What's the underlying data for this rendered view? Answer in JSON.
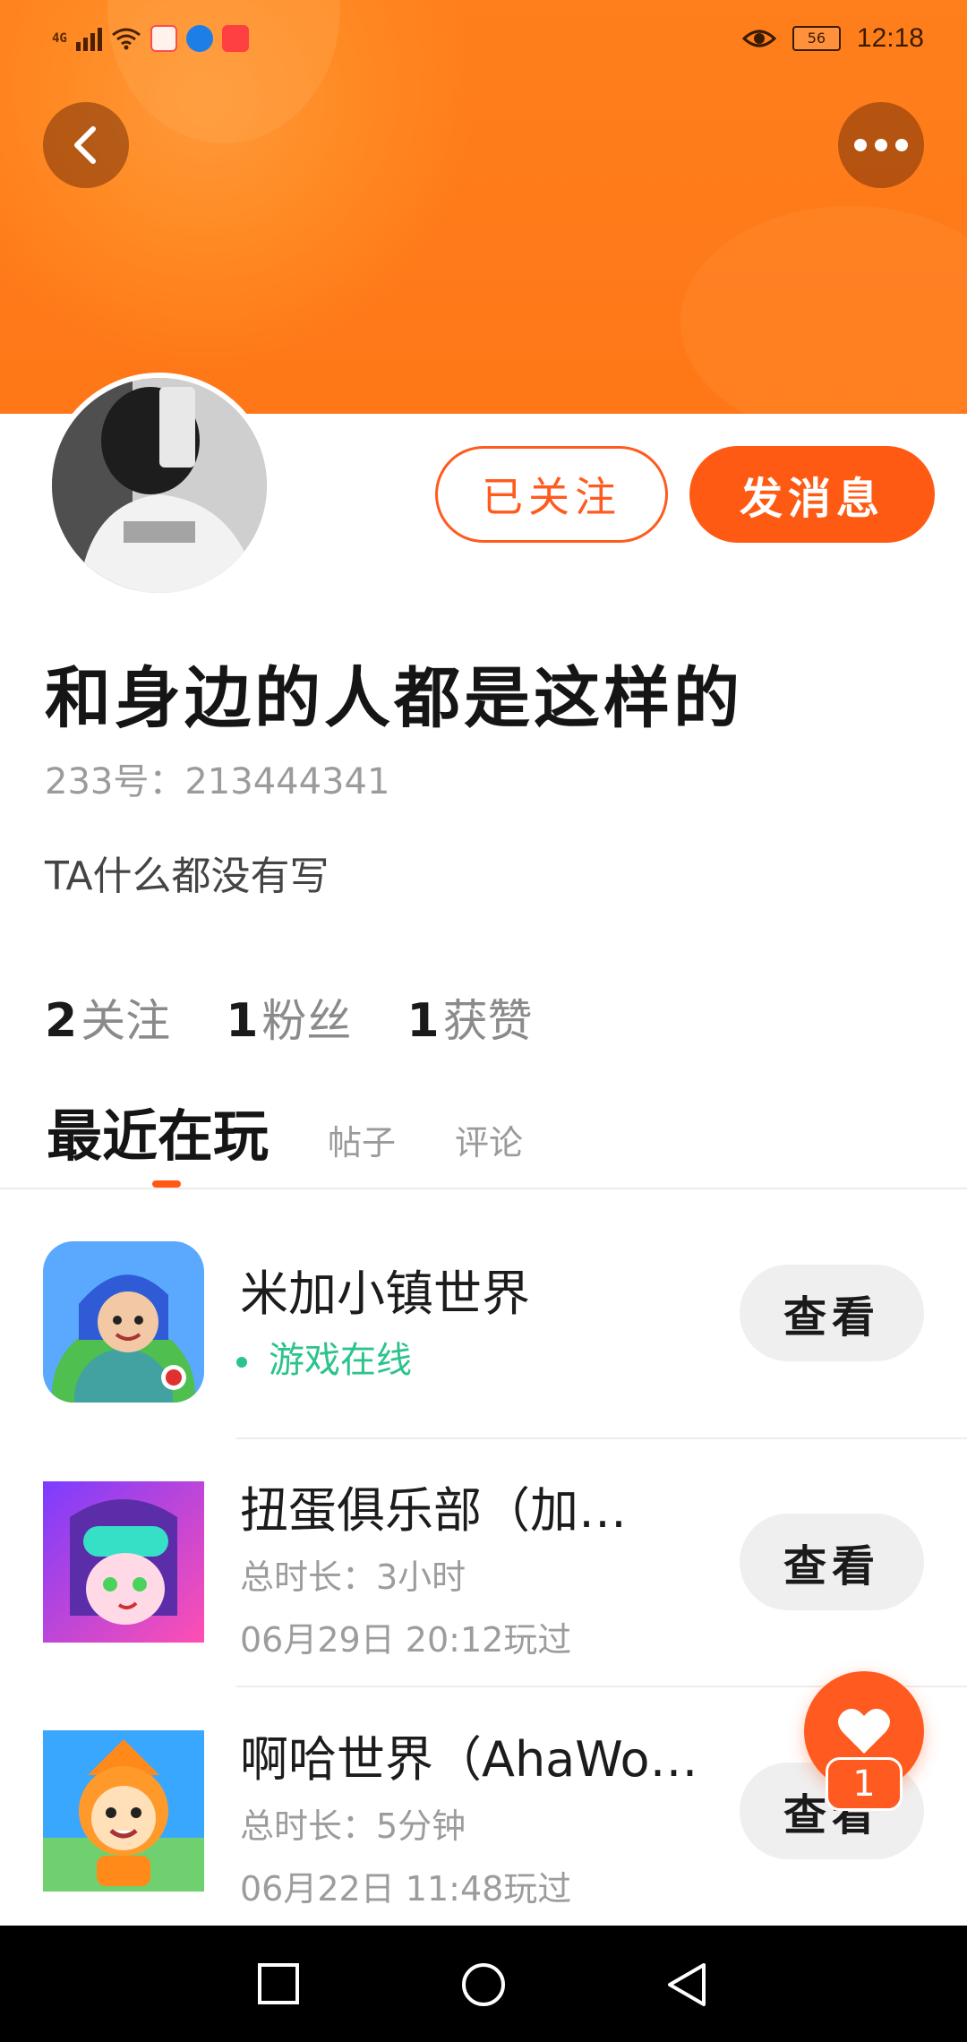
{
  "status_bar": {
    "network": "4G",
    "battery": "56",
    "time": "12:18"
  },
  "profile": {
    "nickname": "和身边的人都是这样的",
    "uid": "233号：213444341",
    "bio": "TA什么都没有写",
    "follow_state_label": "已关注",
    "message_label": "发消息"
  },
  "stats": [
    {
      "num": "2",
      "label": "关注"
    },
    {
      "num": "1",
      "label": "粉丝"
    },
    {
      "num": "1",
      "label": "获赞"
    }
  ],
  "tabs": [
    {
      "label": "最近在玩",
      "active": true
    },
    {
      "label": "帖子",
      "active": false
    },
    {
      "label": "评论",
      "active": false
    }
  ],
  "games": [
    {
      "title": "米加小镇世界",
      "status": "游戏在线",
      "view_label": "查看"
    },
    {
      "title": "扭蛋俱乐部（加…",
      "duration": "总时长：3小时",
      "last_played": "06月29日 20:12玩过",
      "view_label": "查看"
    },
    {
      "title": "啊哈世界（AhaWo…",
      "duration": "总时长：5分钟",
      "last_played": "06月22日 11:48玩过",
      "view_label": "查看"
    }
  ],
  "fab": {
    "badge": "1"
  },
  "colors": {
    "accent": "#ff5a14",
    "online": "#2cc38c",
    "banner": "#ff7f1c"
  }
}
